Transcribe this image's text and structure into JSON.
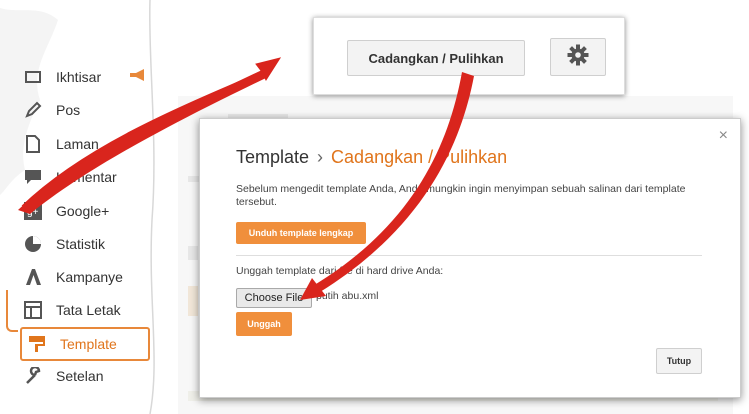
{
  "sidebar": {
    "items": [
      {
        "label": "Ikhtisar",
        "icon": "overview-icon"
      },
      {
        "label": "Pos",
        "icon": "pencil-icon"
      },
      {
        "label": "Laman",
        "icon": "page-icon"
      },
      {
        "label": "Komentar",
        "icon": "comment-icon"
      },
      {
        "label": "Google+",
        "icon": "google-plus-icon"
      },
      {
        "label": "Statistik",
        "icon": "pie-chart-icon"
      },
      {
        "label": "Kampanye",
        "icon": "campaign-icon"
      },
      {
        "label": "Tata Letak",
        "icon": "layout-icon"
      },
      {
        "label": "Template",
        "icon": "paint-roller-icon",
        "active": true
      },
      {
        "label": "Setelan",
        "icon": "wrench-icon"
      }
    ]
  },
  "topbar": {
    "backup_label": "Cadangkan / Pulihkan",
    "gear_icon": "gear-icon"
  },
  "dialog": {
    "title": "Template",
    "separator": "›",
    "subtitle": "Cadangkan / Pulihkan",
    "description": "Sebelum mengedit template Anda, Anda mungkin ingin menyimpan sebuah salinan dari template tersebut.",
    "download_label": "Unduh template lengkap",
    "upload_label": "Unggah template dari file di hard drive Anda:",
    "choose_file_label": "Choose File",
    "file_name": "putih abu.xml",
    "upload_button": "Unggah",
    "close_button": "Tutup",
    "close_x": "×"
  },
  "colors": {
    "accent": "#e0751c",
    "button_orange": "#f08f3c",
    "arrow_red": "#d9251d"
  }
}
